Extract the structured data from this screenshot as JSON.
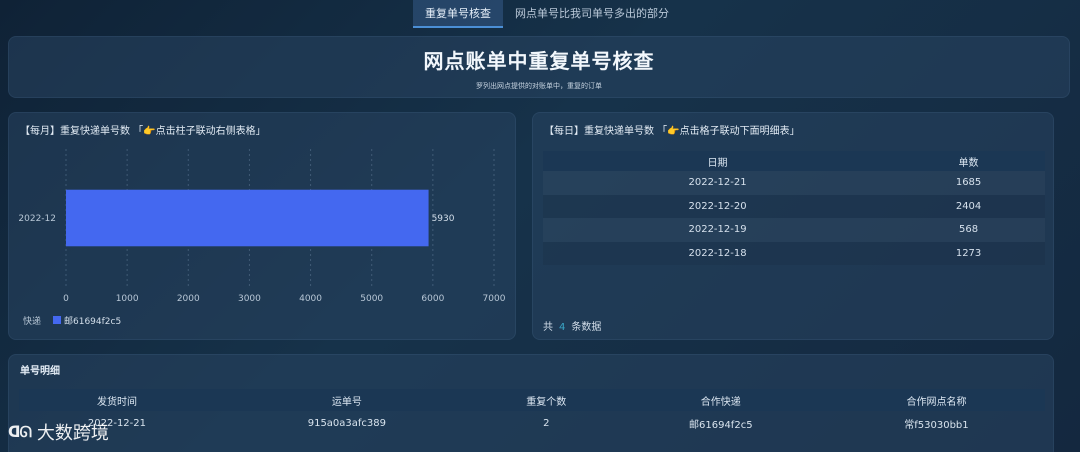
{
  "tabs": [
    {
      "label": "重复单号核查",
      "active": true
    },
    {
      "label": "网点单号比我司单号多出的部分",
      "active": false
    }
  ],
  "header": {
    "title": "网点账单中重复单号核查",
    "subtitle": "罗列出网点提供的对账单中，重复的订单"
  },
  "monthly_panel": {
    "title_prefix": "【每月】重复快递单号数 「",
    "title_suffix": "点击柱子联动右侧表格」",
    "hand_icon": "pointing-hand-icon"
  },
  "daily_panel": {
    "title_prefix": "【每日】重复快递单号数 「",
    "title_suffix": "点击格子联动下面明细表」",
    "columns": [
      "日期",
      "单数"
    ],
    "rows": [
      {
        "date": "2022-12-21",
        "count": "1685"
      },
      {
        "date": "2022-12-20",
        "count": "2404"
      },
      {
        "date": "2022-12-19",
        "count": "568"
      },
      {
        "date": "2022-12-18",
        "count": "1273"
      }
    ],
    "footer_prefix": "共",
    "footer_count": "4",
    "footer_suffix": "条数据"
  },
  "detail_panel": {
    "title": "单号明细",
    "columns": [
      "发货时间",
      "运单号",
      "重复个数",
      "合作快递",
      "合作网点名称"
    ],
    "rows": [
      {
        "time": "2022-12-21",
        "waybill": "915a0a3afc389",
        "dup": "2",
        "express": "邮61694f2c5",
        "branch": "常f53030bb1"
      }
    ]
  },
  "chart_data": {
    "type": "bar",
    "orientation": "horizontal",
    "categories": [
      "2022-12"
    ],
    "series": [
      {
        "name": "邮61694f2c5",
        "values": [
          5930
        ]
      }
    ],
    "legend_title": "快递",
    "xlim": [
      0,
      7000
    ],
    "x_ticks": [
      0,
      1000,
      2000,
      3000,
      4000,
      5000,
      6000,
      7000
    ],
    "grid": true,
    "legend_position": "bottom-left",
    "bar_color": "#4468f0"
  },
  "watermark": {
    "logo": "ᗡᘏ",
    "text": "大数跨境"
  }
}
